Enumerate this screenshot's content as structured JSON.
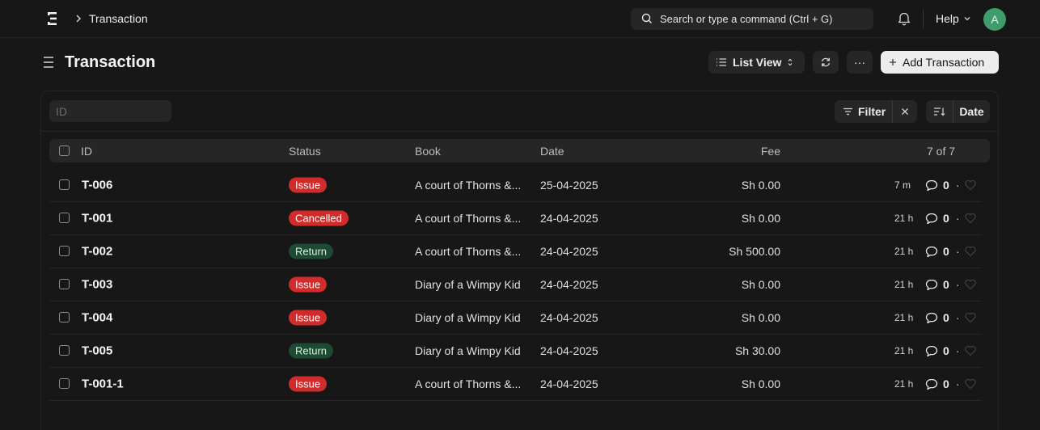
{
  "navbar": {
    "breadcrumb": "Transaction",
    "search_placeholder": "Search or type a command (Ctrl + G)",
    "help_label": "Help",
    "avatar_initial": "A"
  },
  "page": {
    "title": "Transaction",
    "list_view_label": "List View",
    "more_label": "···",
    "add_label": "Add Transaction"
  },
  "filters": {
    "id_placeholder": "ID",
    "filter_label": "Filter",
    "sort_label": "Date"
  },
  "table": {
    "headers": {
      "id": "ID",
      "status": "Status",
      "book": "Book",
      "date": "Date",
      "fee": "Fee",
      "count": "7 of 7"
    },
    "rows": [
      {
        "id": "T-006",
        "status": "Issue",
        "book": "A court of Thorns &...",
        "date": "25-04-2025",
        "fee": "Sh 0.00",
        "ago": "7 m",
        "comments": "0"
      },
      {
        "id": "T-001",
        "status": "Cancelled",
        "book": "A court of Thorns &...",
        "date": "24-04-2025",
        "fee": "Sh 0.00",
        "ago": "21 h",
        "comments": "0"
      },
      {
        "id": "T-002",
        "status": "Return",
        "book": "A court of Thorns &...",
        "date": "24-04-2025",
        "fee": "Sh 500.00",
        "ago": "21 h",
        "comments": "0"
      },
      {
        "id": "T-003",
        "status": "Issue",
        "book": "Diary of a Wimpy Kid",
        "date": "24-04-2025",
        "fee": "Sh 0.00",
        "ago": "21 h",
        "comments": "0"
      },
      {
        "id": "T-004",
        "status": "Issue",
        "book": "Diary of a Wimpy Kid",
        "date": "24-04-2025",
        "fee": "Sh 0.00",
        "ago": "21 h",
        "comments": "0"
      },
      {
        "id": "T-005",
        "status": "Return",
        "book": "Diary of a Wimpy Kid",
        "date": "24-04-2025",
        "fee": "Sh 30.00",
        "ago": "21 h",
        "comments": "0"
      },
      {
        "id": "T-001-1",
        "status": "Issue",
        "book": "A court of Thorns &...",
        "date": "24-04-2025",
        "fee": "Sh 0.00",
        "ago": "21 h",
        "comments": "0"
      }
    ]
  },
  "colors": {
    "Issue": {
      "bg": "#d12b2b",
      "fg": "#ffffff"
    },
    "Cancelled": {
      "bg": "#d12b2b",
      "fg": "#ffffff"
    },
    "Return": {
      "bg": "#1c4a32",
      "fg": "#d7f0e0"
    },
    "accent_avatar": "#3f9d6d"
  }
}
